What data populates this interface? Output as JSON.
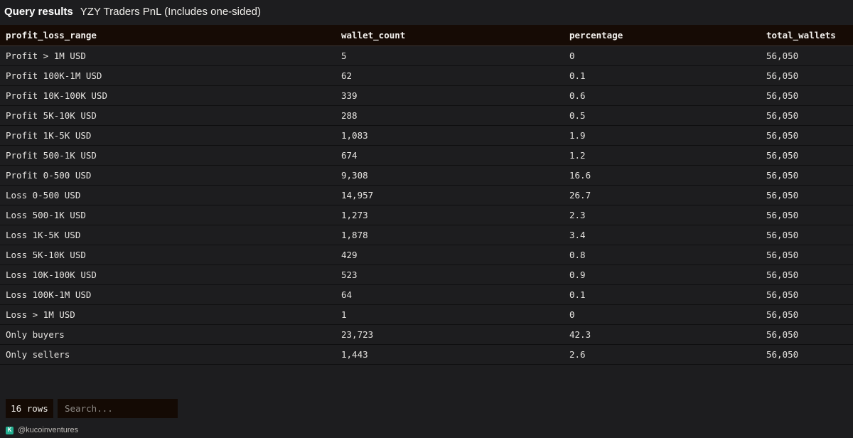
{
  "header": {
    "section_label": "Query results",
    "query_title": "YZY Traders PnL (Includes one-sided)"
  },
  "table": {
    "columns": [
      "profit_loss_range",
      "wallet_count",
      "percentage",
      "total_wallets"
    ],
    "rows": [
      [
        "Profit > 1M USD",
        "5",
        "0",
        "56,050"
      ],
      [
        "Profit 100K-1M USD",
        "62",
        "0.1",
        "56,050"
      ],
      [
        "Profit 10K-100K USD",
        "339",
        "0.6",
        "56,050"
      ],
      [
        "Profit 5K-10K USD",
        "288",
        "0.5",
        "56,050"
      ],
      [
        "Profit 1K-5K USD",
        "1,083",
        "1.9",
        "56,050"
      ],
      [
        "Profit 500-1K USD",
        "674",
        "1.2",
        "56,050"
      ],
      [
        "Profit 0-500 USD",
        "9,308",
        "16.6",
        "56,050"
      ],
      [
        "Loss 0-500 USD",
        "14,957",
        "26.7",
        "56,050"
      ],
      [
        "Loss 500-1K USD",
        "1,273",
        "2.3",
        "56,050"
      ],
      [
        "Loss 1K-5K USD",
        "1,878",
        "3.4",
        "56,050"
      ],
      [
        "Loss 5K-10K USD",
        "429",
        "0.8",
        "56,050"
      ],
      [
        "Loss 10K-100K USD",
        "523",
        "0.9",
        "56,050"
      ],
      [
        "Loss 100K-1M USD",
        "64",
        "0.1",
        "56,050"
      ],
      [
        "Loss > 1M USD",
        "1",
        "0",
        "56,050"
      ],
      [
        "Only buyers",
        "23,723",
        "42.3",
        "56,050"
      ],
      [
        "Only sellers",
        "1,443",
        "2.6",
        "56,050"
      ]
    ]
  },
  "footer": {
    "row_count_label": "16 rows",
    "search_placeholder": "Search..."
  },
  "credit": {
    "logo_letter": "K",
    "handle": "@kucoinventures",
    "logo_color": "#23af91"
  }
}
